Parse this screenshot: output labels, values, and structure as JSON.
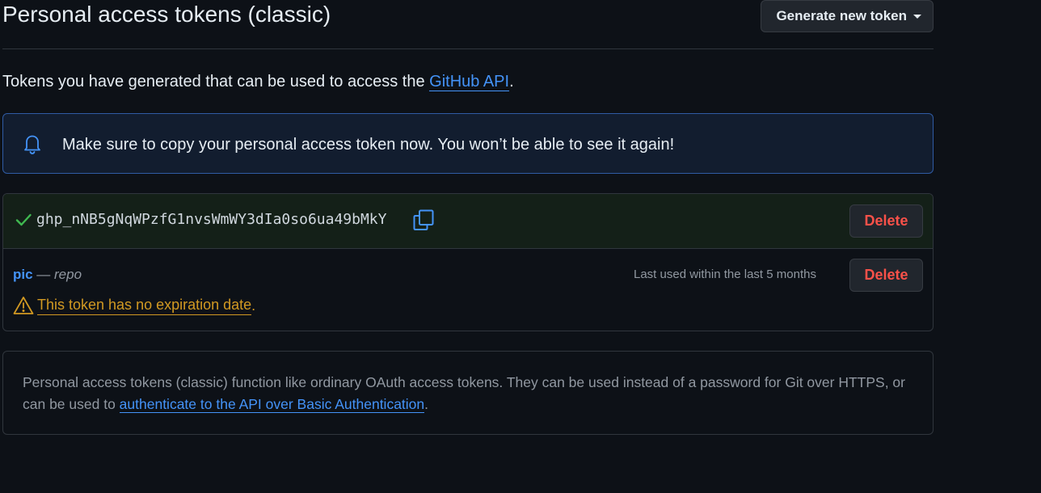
{
  "header": {
    "title": "Personal access tokens (classic)",
    "generate_button_label": "Generate new token"
  },
  "intro": {
    "text_before": "Tokens you have generated that can be used to access the ",
    "link_text": "GitHub API",
    "text_after": "."
  },
  "flash": {
    "icon": "bell-icon",
    "message": "Make sure to copy your personal access token now. You won’t be able to see it again!"
  },
  "tokens": {
    "new_token": {
      "status_icon": "check-icon",
      "value": "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",
      "copy_icon": "copy-icon",
      "delete_label": "Delete"
    },
    "items": [
      {
        "name": "pic",
        "separator": " — ",
        "scope": "repo",
        "last_used": "Last used within the last 5 months",
        "warning_icon": "alert-icon",
        "warning_text": "This token has no expiration date",
        "warning_suffix": ".",
        "delete_label": "Delete"
      }
    ]
  },
  "info": {
    "text_before": "Personal access tokens (classic) function like ordinary OAuth access tokens. They can be used instead of a password for Git over HTTPS, or can be used to ",
    "link_text": "authenticate to the API over Basic Authentication",
    "text_after": "."
  },
  "colors": {
    "background": "#0d1117",
    "link": "#4493f8",
    "danger": "#f85149",
    "attention": "#d29922",
    "success": "#3fb950",
    "flash_bg": "#121d2f",
    "flash_border": "#2f5ba4",
    "new_token_bg": "#142018"
  }
}
